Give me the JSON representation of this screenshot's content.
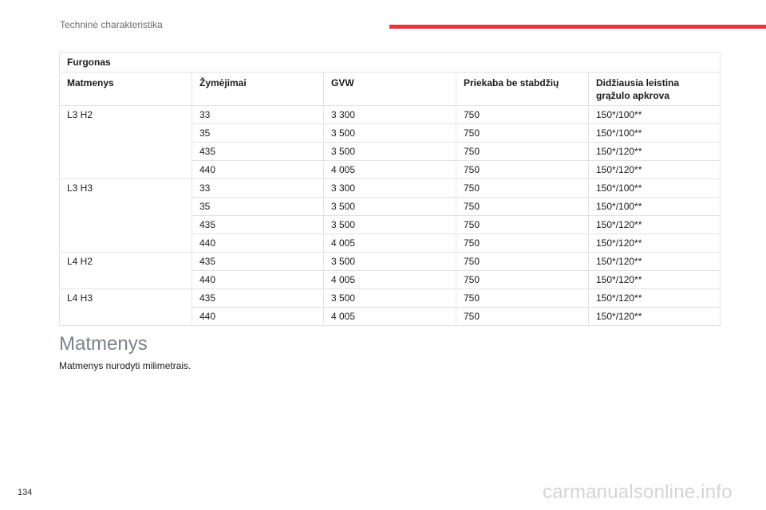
{
  "header": {
    "title": "Techninė charakteristika"
  },
  "table": {
    "title": "Furgonas",
    "columns": [
      "Matmenys",
      "Žymėjimai",
      "GVW",
      "Priekaba be stabdžių",
      "Didžiausia leistina grąžulo apkrova"
    ],
    "groups": [
      {
        "model": "L3 H2",
        "rows": [
          [
            "33",
            "3 300",
            "750",
            "150*/100**"
          ],
          [
            "35",
            "3 500",
            "750",
            "150*/100**"
          ],
          [
            "435",
            "3 500",
            "750",
            "150*/120**"
          ],
          [
            "440",
            "4 005",
            "750",
            "150*/120**"
          ]
        ]
      },
      {
        "model": "L3 H3",
        "rows": [
          [
            "33",
            "3 300",
            "750",
            "150*/100**"
          ],
          [
            "35",
            "3 500",
            "750",
            "150*/100**"
          ],
          [
            "435",
            "3 500",
            "750",
            "150*/120**"
          ],
          [
            "440",
            "4 005",
            "750",
            "150*/120**"
          ]
        ]
      },
      {
        "model": "L4 H2",
        "rows": [
          [
            "435",
            "3 500",
            "750",
            "150*/120**"
          ],
          [
            "440",
            "4 005",
            "750",
            "150*/120**"
          ]
        ]
      },
      {
        "model": "L4 H3",
        "rows": [
          [
            "435",
            "3 500",
            "750",
            "150*/120**"
          ],
          [
            "440",
            "4 005",
            "750",
            "150*/120**"
          ]
        ]
      }
    ]
  },
  "section": {
    "title": "Matmenys",
    "text": "Matmenys nurodyti milimetrais."
  },
  "page_number": "134",
  "watermark": "carmanualsonline.info",
  "colors": {
    "accent_bar": "#e8333a",
    "heading": "#7a8289",
    "border": "#e2e2e2"
  }
}
